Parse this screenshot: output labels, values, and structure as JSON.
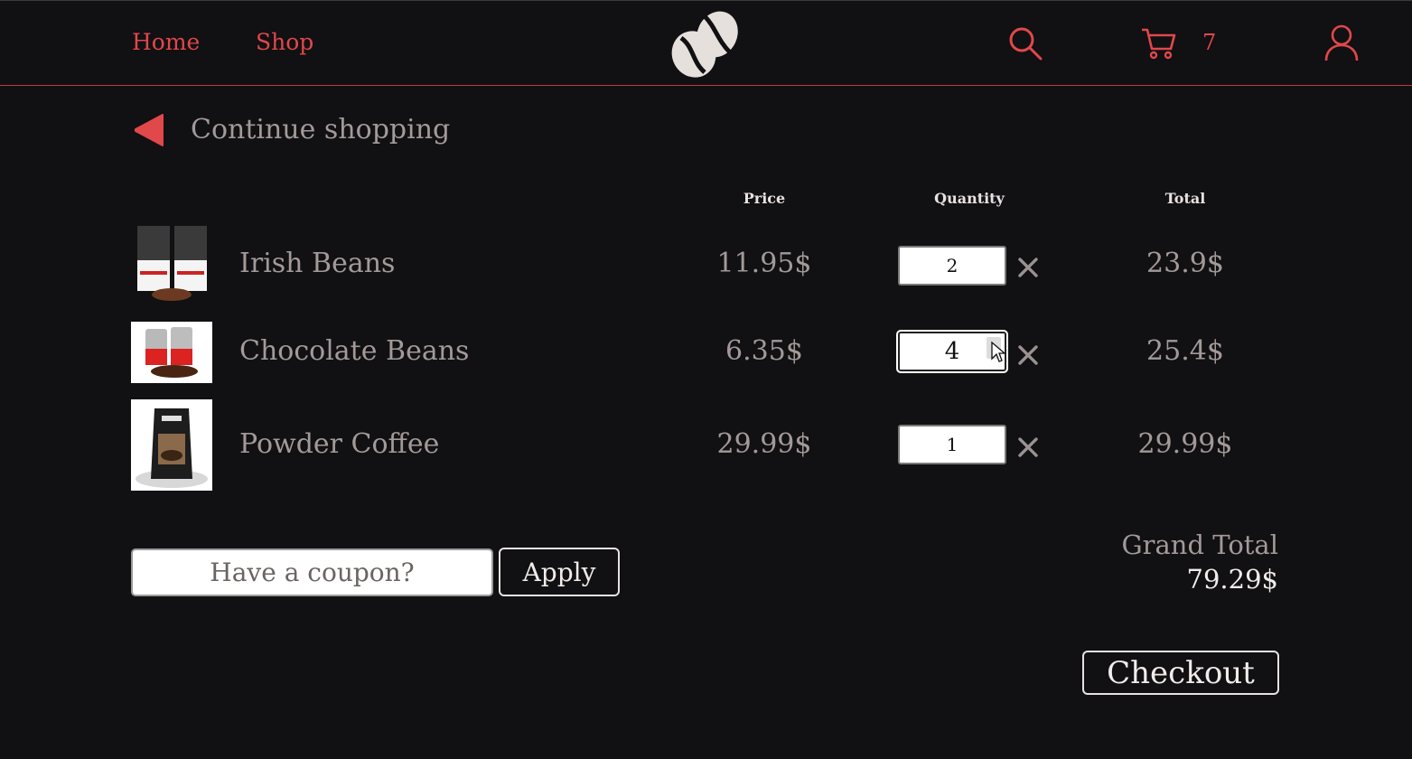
{
  "header": {
    "nav": [
      {
        "label": "Home"
      },
      {
        "label": "Shop"
      }
    ],
    "cart_count": "7",
    "accent_color": "#e0484a",
    "icons": [
      "coffee-bean-logo",
      "search-icon",
      "cart-icon",
      "user-icon"
    ]
  },
  "back": {
    "label": "Continue shopping"
  },
  "table": {
    "columns": {
      "price": "Price",
      "quantity": "Quantity",
      "total": "Total"
    },
    "rows": [
      {
        "name": "Irish Beans",
        "price": "11.95$",
        "quantity": "2",
        "total": "23.9$"
      },
      {
        "name": "Chocolate Beans",
        "price": "6.35$",
        "quantity": "4",
        "total": "25.4$"
      },
      {
        "name": "Powder Coffee",
        "price": "29.99$",
        "quantity": "1",
        "total": "29.99$"
      }
    ]
  },
  "coupon": {
    "placeholder": "Have a coupon?",
    "apply_label": "Apply"
  },
  "summary": {
    "grand_total_label": "Grand Total",
    "grand_total_value": "79.29$"
  },
  "checkout_label": "Checkout",
  "colors": {
    "background": "#111013",
    "accent": "#e0484a",
    "text_muted": "#a39a98",
    "text_light": "#f1ece9"
  }
}
